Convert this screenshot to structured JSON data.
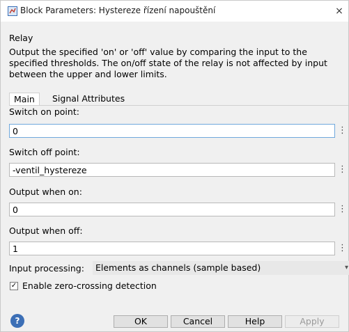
{
  "window": {
    "title": "Block Parameters: Hystereze řízení napouštění",
    "close_glyph": "×",
    "title_icon": "simulink-block-icon"
  },
  "block": {
    "type": "Relay",
    "description": "Output the specified 'on' or 'off' value by comparing the input to the specified thresholds.  The on/off state of the relay is not affected by input between the upper and lower limits."
  },
  "tabs": [
    {
      "label": "Main",
      "active": true
    },
    {
      "label": "Signal Attributes",
      "active": false
    }
  ],
  "params": {
    "switch_on": {
      "label": "Switch on point:",
      "value": "0"
    },
    "switch_off": {
      "label": "Switch off point:",
      "value": "-ventil_hystereze"
    },
    "output_on": {
      "label": "Output when on:",
      "value": "0"
    },
    "output_off": {
      "label": "Output when off:",
      "value": "1"
    },
    "kebab_glyph": "⋮"
  },
  "input_processing": {
    "label": "Input processing:",
    "value": "Elements as channels (sample based)"
  },
  "zero_crossing": {
    "label": "Enable zero-crossing detection",
    "checked": true,
    "check_glyph": "✓"
  },
  "buttons": {
    "help_glyph": "?",
    "ok": "OK",
    "cancel": "Cancel",
    "help": "Help",
    "apply": "Apply"
  }
}
